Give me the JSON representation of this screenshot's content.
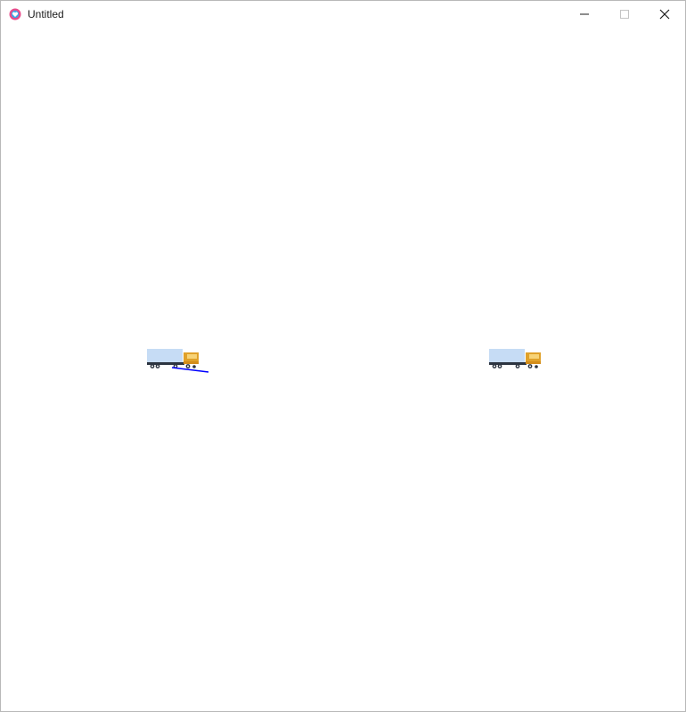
{
  "window": {
    "title": "Untitled",
    "app_icon": "heart-app-icon",
    "controls": {
      "minimize_icon": "minimize-icon",
      "maximize_icon": "maximize-icon",
      "close_icon": "close-icon"
    }
  },
  "canvas": {
    "background": "#ffffff",
    "sprites": [
      {
        "name": "truck-sprite",
        "icon": "truck-icon"
      },
      {
        "name": "truck-sprite",
        "icon": "truck-icon"
      }
    ],
    "heading_line_color": "#0000ff"
  },
  "colors": {
    "truck_container": "#c6dcf5",
    "truck_cab": "#e0a12a",
    "truck_chassis": "#2c3440",
    "app_icon_pink": "#e84c8b",
    "app_icon_blue": "#3aa7e6"
  }
}
